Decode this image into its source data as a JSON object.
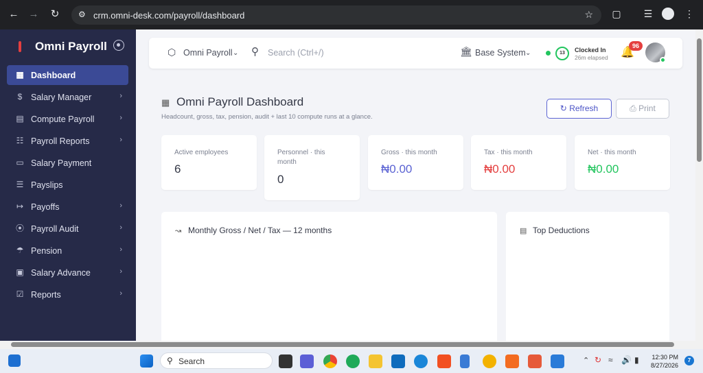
{
  "browser": {
    "url": "crm.omni-desk.com/payroll/dashboard"
  },
  "sidebar": {
    "brand": "Omni Payroll",
    "items": [
      {
        "label": "Dashboard",
        "icon": "grid-icon",
        "active": true,
        "chevron": false
      },
      {
        "label": "Salary Manager",
        "icon": "dollar-icon",
        "active": false,
        "chevron": true
      },
      {
        "label": "Compute Payroll",
        "icon": "calculator-icon",
        "active": false,
        "chevron": true
      },
      {
        "label": "Payroll Reports",
        "icon": "file-icon",
        "active": false,
        "chevron": true
      },
      {
        "label": "Salary Payment",
        "icon": "card-icon",
        "active": false,
        "chevron": false
      },
      {
        "label": "Payslips",
        "icon": "document-icon",
        "active": false,
        "chevron": false
      },
      {
        "label": "Payoffs",
        "icon": "exit-icon",
        "active": false,
        "chevron": true
      },
      {
        "label": "Payroll Audit",
        "icon": "audit-icon",
        "active": false,
        "chevron": true
      },
      {
        "label": "Pension",
        "icon": "umbrella-icon",
        "active": false,
        "chevron": true
      },
      {
        "label": "Salary Advance",
        "icon": "wallet-icon",
        "active": false,
        "chevron": true
      },
      {
        "label": "Reports",
        "icon": "clipboard-icon",
        "active": false,
        "chevron": true
      }
    ]
  },
  "topbar": {
    "company": "Omni Payroll",
    "search_placeholder": "Search (Ctrl+/)",
    "system": "Base System",
    "clock_count": "13",
    "clock_status": "Clocked In",
    "clock_elapsed": "26m elapsed",
    "notifications": "96"
  },
  "page": {
    "title": "Omni Payroll Dashboard",
    "subtitle": "Headcount, gross, tax, pension, audit + last 10 compute runs at a glance.",
    "refresh_label": "Refresh",
    "print_label": "Print"
  },
  "kpis": [
    {
      "label": "Active employees",
      "value": "6",
      "color": "#343846"
    },
    {
      "label": "Personnel · this month",
      "value": "0",
      "color": "#343846"
    },
    {
      "label": "Gross · this month",
      "value": "₦0.00",
      "color": "#5b63d3"
    },
    {
      "label": "Tax · this month",
      "value": "₦0.00",
      "color": "#e43f3f"
    },
    {
      "label": "Net · this month",
      "value": "₦0.00",
      "color": "#22c55e"
    }
  ],
  "panels": {
    "chart_title": "Monthly Gross / Net / Tax — 12 months",
    "deductions_title": "Top Deductions"
  },
  "taskbar": {
    "search": "Search",
    "time": "12:30 PM",
    "date": "8/27/2026",
    "notif_count": "7"
  }
}
